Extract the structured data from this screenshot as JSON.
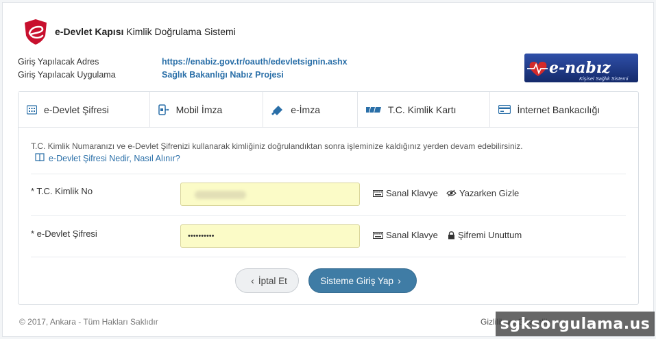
{
  "header": {
    "brand_bold": "e-Devlet Kapısı",
    "brand_rest": " Kimlik Doğrulama Sistemi"
  },
  "meta": {
    "address_label": "Giriş Yapılacak Adres",
    "address_value": "https://enabiz.gov.tr/oauth/edevletsignin.ashx",
    "app_label": "Giriş Yapılacak Uygulama",
    "app_value": "Sağlık Bakanlığı Nabız Projesi"
  },
  "enabiz_logo": {
    "brand": "e-nabız",
    "subtitle": "Kişisel Sağlık Sistemi"
  },
  "tabs": [
    {
      "label": "e-Devlet Şifresi",
      "icon": "keypad-icon",
      "active": true
    },
    {
      "label": "Mobil İmza",
      "icon": "mobile-signature-icon",
      "active": false
    },
    {
      "label": "e-İmza",
      "icon": "usb-token-icon",
      "active": false
    },
    {
      "label": "T.C. Kimlik Kartı",
      "icon": "id-card-icon",
      "active": false
    },
    {
      "label": "İnternet Bankacılığı",
      "icon": "bank-card-icon",
      "active": false
    }
  ],
  "info_text": "T.C. Kimlik Numaranızı ve e-Devlet Şifrenizi kullanarak kimliğiniz doğrulandıktan sonra işleminize kaldığınız yerden devam edebilirsiniz.",
  "help_link": "e-Devlet Şifresi Nedir, Nasıl Alınır?",
  "fields": {
    "tc_label": "* T.C. Kimlik No",
    "password_label": "* e-Devlet Şifresi",
    "password_value": "••••••••••",
    "virtual_keyboard": "Sanal Klavye",
    "hide_while_typing": "Yazarken Gizle",
    "forgot_password": "Şifremi Unuttum"
  },
  "buttons": {
    "cancel": "İptal Et",
    "submit": "Sisteme Giriş Yap"
  },
  "footer": {
    "copyright": "© 2017, Ankara - Tüm Hakları Saklıdır",
    "right_text": "Gizlilik ve Güvenlik"
  },
  "watermark": "sgksorgulama.us",
  "colors": {
    "accent": "#3f7ca5",
    "link": "#2a6fa8",
    "input_bg": "#fbfbc7",
    "logo_red": "#c8102e"
  }
}
